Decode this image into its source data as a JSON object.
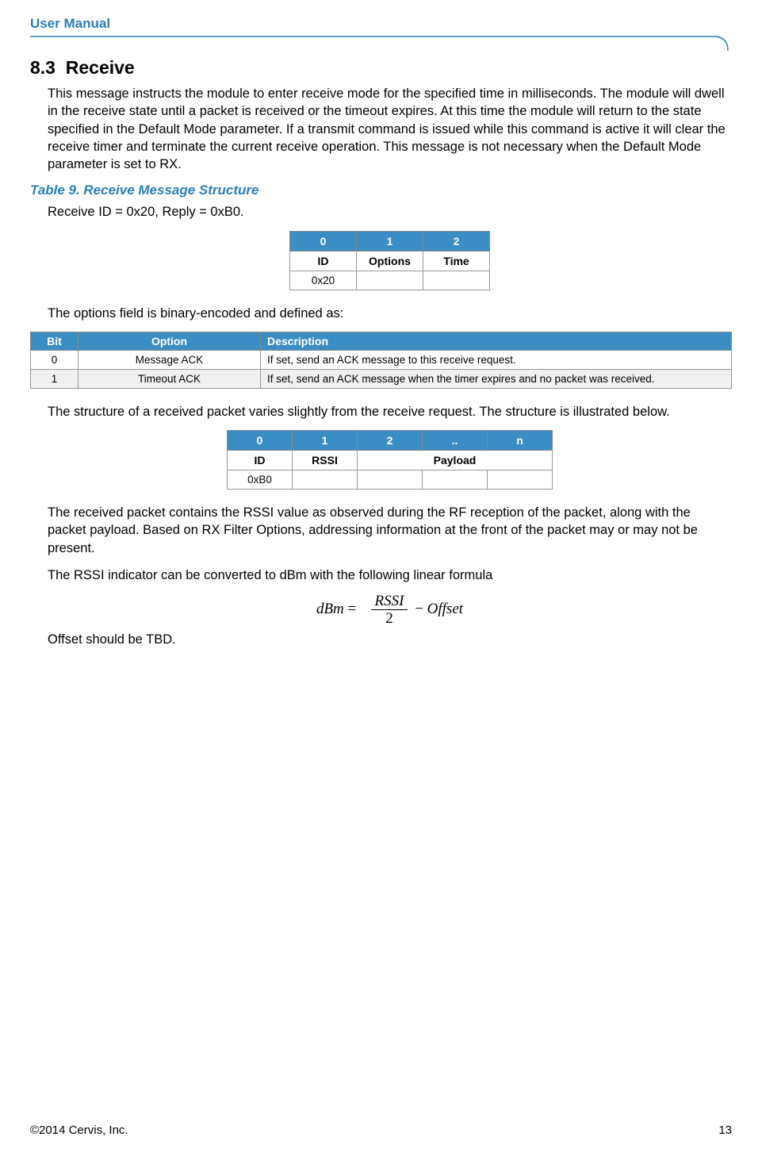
{
  "header": {
    "title": "User Manual"
  },
  "section": {
    "number": "8.3",
    "title": "Receive",
    "intro": "This message instructs the module to enter receive mode for the specified time in milliseconds.  The module will dwell in the receive state until a packet is received or the timeout expires.  At this time the module will return to the state specified in the Default Mode parameter.  If a transmit command is issued while this command is active it will clear the receive timer and terminate the current receive operation.  This message is not necessary when the Default Mode parameter is set to RX."
  },
  "table9": {
    "caption": "Table 9. Receive Message Structure",
    "idline": "Receive ID = 0x20, Reply = 0xB0.",
    "headers": [
      "0",
      "1",
      "2"
    ],
    "labels": [
      "ID",
      "Options",
      "Time"
    ],
    "values": [
      "0x20",
      "",
      ""
    ]
  },
  "options_intro": "The options field is binary-encoded and defined as:",
  "options_table": {
    "headers": [
      "Bit",
      "Option",
      "Description"
    ],
    "rows": [
      {
        "bit": "0",
        "option": "Message ACK",
        "desc": "If set, send an ACK message to this receive request."
      },
      {
        "bit": "1",
        "option": "Timeout ACK",
        "desc": "If set, send an ACK message when the timer expires and no packet was received."
      }
    ]
  },
  "struct_intro": "The structure of a received packet varies slightly from the receive request.  The structure is illustrated below.",
  "recv_table": {
    "headers": [
      "0",
      "1",
      "2",
      "..",
      "n"
    ],
    "labels": [
      "ID",
      "RSSI",
      "Payload"
    ],
    "values": [
      "0xB0",
      "",
      "",
      "",
      ""
    ]
  },
  "rssi_para": "The received packet contains the RSSI value as observed during the RF reception of the packet, along with the packet payload.  Based on RX Filter Options, addressing information at the front of the packet may or may not be present.",
  "formula_intro": "The RSSI indicator can be converted to dBm with the following linear formula",
  "formula": {
    "lhs": "dBm",
    "eq": "=",
    "num": "RSSI",
    "den": "2",
    "minus": "−",
    "rhs": "Offset"
  },
  "offset_note": "Offset should be TBD.",
  "footer": {
    "left": "©2014 Cervis, Inc.",
    "right": "13"
  }
}
